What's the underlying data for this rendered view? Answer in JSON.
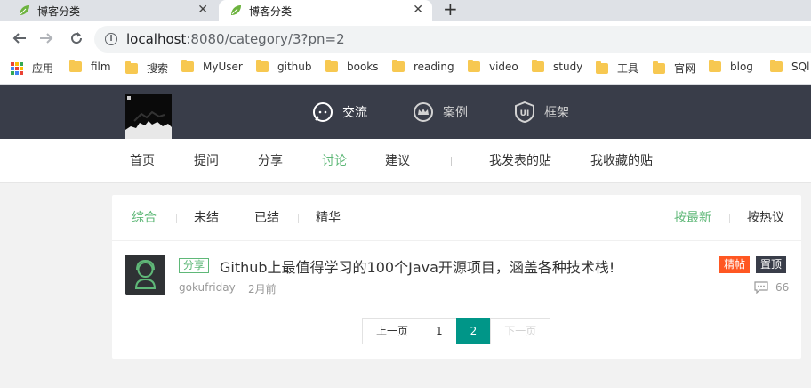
{
  "browser": {
    "tabs": [
      {
        "title": "博客分类"
      },
      {
        "title": "博客分类"
      }
    ],
    "new_tab": "+",
    "url_host": "localhost",
    "url_path": ":8080/category/3?pn=2",
    "bookmarks": [
      {
        "label": "应用",
        "icon": "apps-icon"
      },
      {
        "label": "film",
        "icon": "folder-icon"
      },
      {
        "label": "搜索",
        "icon": "folder-icon"
      },
      {
        "label": "MyUser",
        "icon": "folder-icon"
      },
      {
        "label": "github",
        "icon": "folder-icon"
      },
      {
        "label": "books",
        "icon": "folder-icon"
      },
      {
        "label": "reading",
        "icon": "folder-icon"
      },
      {
        "label": "video",
        "icon": "folder-icon"
      },
      {
        "label": "study",
        "icon": "folder-icon"
      },
      {
        "label": "工具",
        "icon": "folder-icon"
      },
      {
        "label": "官网",
        "icon": "folder-icon"
      },
      {
        "label": "blog",
        "icon": "folder-icon"
      },
      {
        "label": "SQl",
        "icon": "folder-icon"
      }
    ]
  },
  "header": {
    "nav": [
      {
        "label": "交流",
        "icon": "chat-icon"
      },
      {
        "label": "案例",
        "icon": "crown-icon"
      },
      {
        "label": "框架",
        "icon": "ui-shield-icon"
      }
    ]
  },
  "subnav": {
    "items": [
      "首页",
      "提问",
      "分享",
      "讨论",
      "建议"
    ],
    "active": "讨论",
    "right_items": [
      "我发表的贴",
      "我收藏的贴"
    ]
  },
  "filters": {
    "left": [
      "综合",
      "未结",
      "已结",
      "精华"
    ],
    "right": [
      "按最新",
      "按热议"
    ]
  },
  "post": {
    "tag": "分享",
    "title": "Github上最值得学习的100个Java开源项目，涵盖各种技术栈!",
    "author": "gokufriday",
    "time": "2月前",
    "badges": [
      "精帖",
      "置顶"
    ],
    "reply_count": "66"
  },
  "pagination": {
    "prev": "上一页",
    "pages": [
      "1",
      "2"
    ],
    "current": "2",
    "next": "下一页"
  },
  "colors": {
    "accent_green": "#5fb878",
    "teal": "#009688",
    "header_bg": "#393d49",
    "badge_orange": "#ff5722"
  }
}
